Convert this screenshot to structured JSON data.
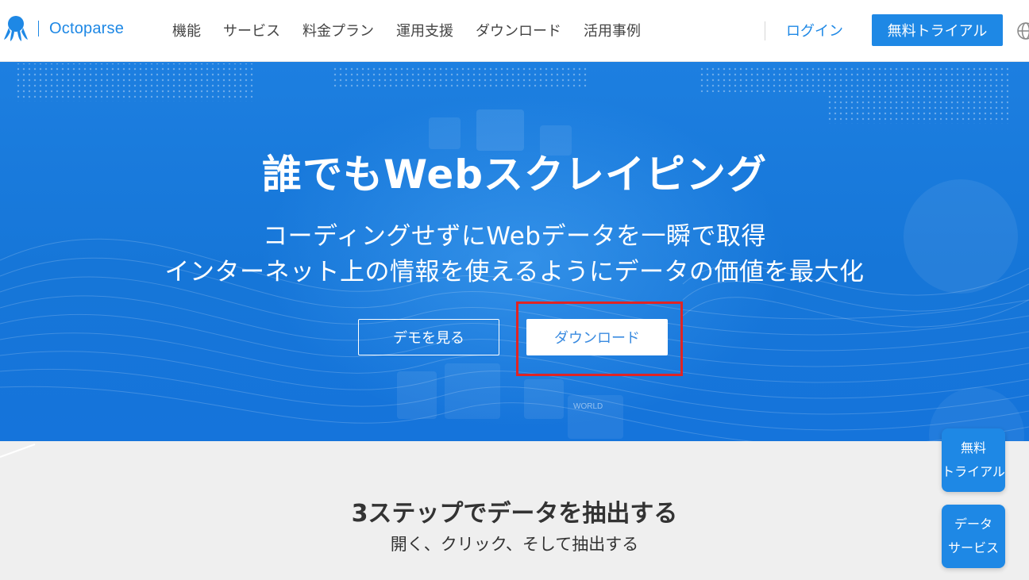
{
  "header": {
    "logo_text": "Octoparse",
    "nav": [
      "機能",
      "サービス",
      "料金プラン",
      "運用支援",
      "ダウンロード",
      "活用事例"
    ],
    "login_label": "ログイン",
    "trial_label": "無料トライアル"
  },
  "hero": {
    "title": "誰でもWebスクレイピング",
    "subtitle_line1": "コーディングせずにWebデータを一瞬で取得",
    "subtitle_line2": "インターネット上の情報を使えるようにデータの価値を最大化",
    "demo_label": "デモを見る",
    "download_label": "ダウンロード",
    "decor_text": "WORLD"
  },
  "steps": {
    "title": "3ステップでデータを抽出する",
    "subtitle": "開く、クリック、そして抽出する"
  },
  "floating": {
    "trial_line1": "無料",
    "trial_line2": "トライアル",
    "data_line1": "データ",
    "data_line2": "サービス"
  },
  "colors": {
    "brand": "#1e88e5",
    "hero_bg": "#1676d8",
    "highlight": "#e02424"
  }
}
